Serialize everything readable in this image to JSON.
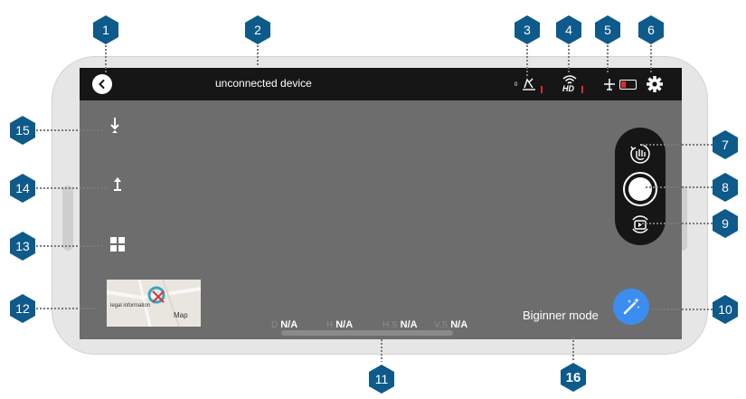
{
  "status_bar": {
    "device_status": "unconnected device",
    "gps_signal_count": "0",
    "video_quality": "HD"
  },
  "telemetry": {
    "distance_key": "D",
    "distance_value": "N/A",
    "height_key": "H",
    "height_value": "N/A",
    "h_speed_key": "H.S",
    "h_speed_value": "N/A",
    "v_speed_key": "V.S",
    "v_speed_value": "N/A"
  },
  "map": {
    "legal_text": "legal information",
    "label": "Map"
  },
  "mode": {
    "label": "Biginner mode"
  },
  "callouts": [
    "1",
    "2",
    "3",
    "4",
    "5",
    "6",
    "7",
    "8",
    "9",
    "10",
    "11",
    "12",
    "13",
    "14",
    "15",
    "16"
  ],
  "colors": {
    "callout": "#0e5a8a",
    "accent": "#3b8ef0",
    "warning": "#e0282e",
    "bar": "#161616"
  }
}
